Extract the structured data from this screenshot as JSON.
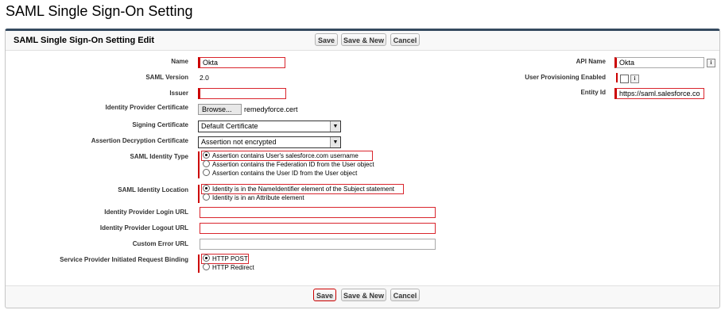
{
  "page": {
    "title": "SAML Single Sign-On Setting"
  },
  "panel": {
    "title": "SAML Single Sign-On Setting Edit"
  },
  "buttons": {
    "save": "Save",
    "save_new": "Save & New",
    "cancel": "Cancel"
  },
  "fields": {
    "name": {
      "label": "Name",
      "value": "Okta"
    },
    "saml_version": {
      "label": "SAML Version",
      "value": "2.0"
    },
    "issuer": {
      "label": "Issuer",
      "value": ""
    },
    "idp_certificate": {
      "label": "Identity Provider Certificate",
      "browse": "Browse...",
      "filename": "remedyforce.cert"
    },
    "signing_certificate": {
      "label": "Signing Certificate",
      "value": "Default Certificate"
    },
    "assertion_decryption": {
      "label": "Assertion Decryption Certificate",
      "value": "Assertion not encrypted"
    },
    "identity_type": {
      "label": "SAML Identity Type",
      "options": [
        "Assertion contains User's salesforce.com username",
        "Assertion contains the Federation ID from the User object",
        "Assertion contains the User ID from the User object"
      ],
      "selected": 0
    },
    "identity_location": {
      "label": "SAML Identity Location",
      "options": [
        "Identity is in the NameIdentifier element of the Subject statement",
        "Identity is in an Attribute element"
      ],
      "selected": 0
    },
    "login_url": {
      "label": "Identity Provider Login URL",
      "value": ""
    },
    "logout_url": {
      "label": "Identity Provider Logout URL",
      "value": ""
    },
    "custom_error_url": {
      "label": "Custom Error URL",
      "value": ""
    },
    "sp_binding": {
      "label": "Service Provider Initiated Request Binding",
      "options": [
        "HTTP POST",
        "HTTP Redirect"
      ],
      "selected": 0
    },
    "api_name": {
      "label": "API Name",
      "value": "Okta",
      "info": "i"
    },
    "user_provisioning": {
      "label": "User Provisioning Enabled",
      "checked": false,
      "info": "i"
    },
    "entity_id": {
      "label": "Entity Id",
      "value": "https://saml.salesforce.co"
    }
  }
}
